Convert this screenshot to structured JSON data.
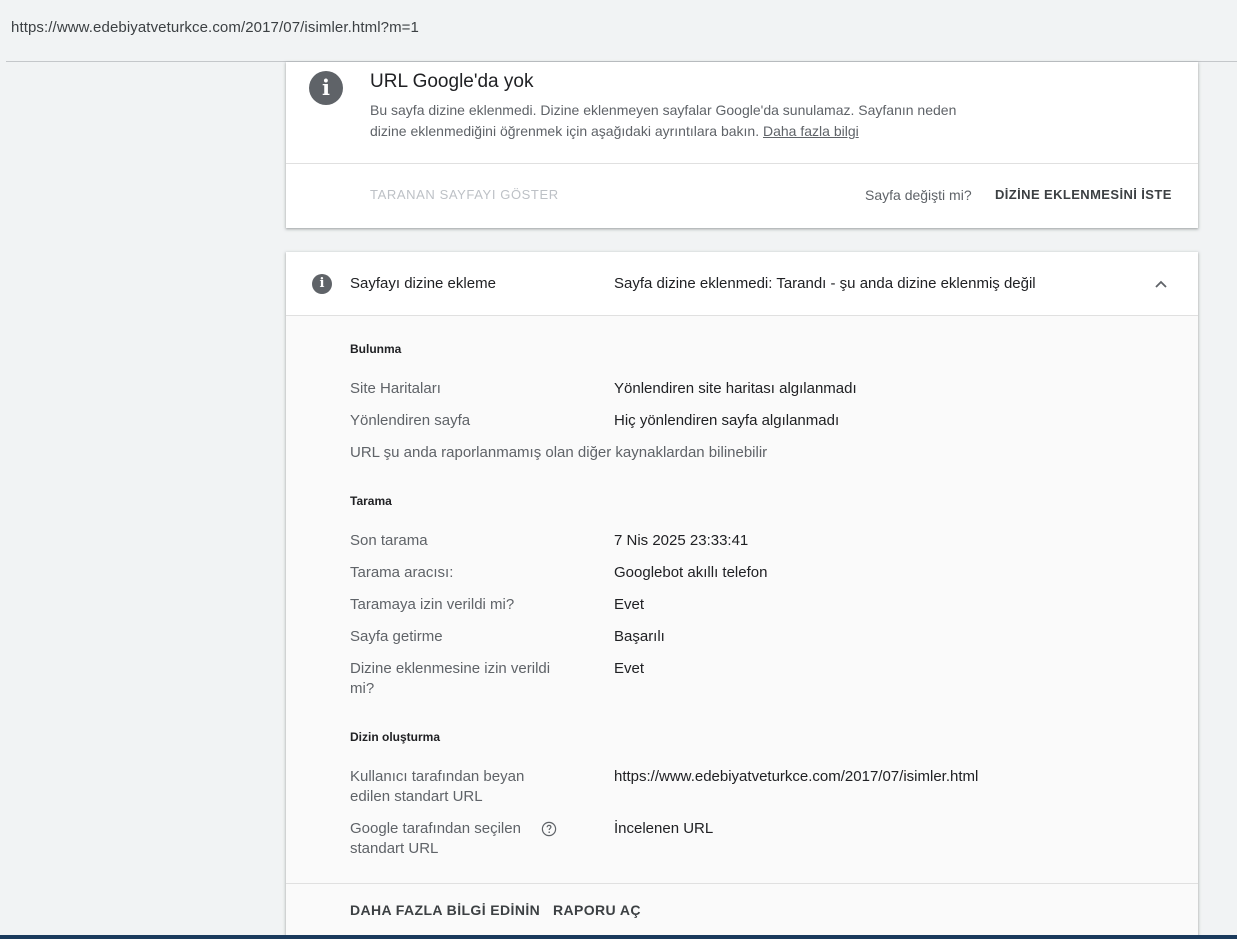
{
  "browser": {
    "url": "https://www.edebiyatveturkce.com/2017/07/isimler.html?m=1"
  },
  "status_card": {
    "title": "URL Google'da yok",
    "description": "Bu sayfa dizine eklenmedi. Dizine eklenmeyen sayfalar Google'da sunulamaz. Sayfanın neden dizine eklenmediğini öğrenmek için aşağıdaki ayrıntılara bakın.",
    "learn_more_link": "Daha fazla bilgi",
    "view_crawled_button": "TARANAN SAYFAYI GÖSTER",
    "page_changed_text": "Sayfa değişti mi?",
    "request_indexing_button": "DİZİNE EKLENMESİNİ İSTE"
  },
  "details_card": {
    "header_label": "Sayfayı dizine ekleme",
    "header_status": "Sayfa dizine eklenmedi: Tarandı - şu anda dizine eklenmiş değil",
    "discovery": {
      "title": "Bulunma",
      "sitemaps_label": "Site Haritaları",
      "sitemaps_value": "Yönlendiren site haritası algılanmadı",
      "referring_page_label": "Yönlendiren sayfa",
      "referring_page_value": "Hiç yönlendiren sayfa algılanmadı",
      "note": "URL şu anda raporlanmamış olan diğer kaynaklardan bilinebilir"
    },
    "crawl": {
      "title": "Tarama",
      "last_crawl_label": "Son tarama",
      "last_crawl_value": "7 Nis 2025 23:33:41",
      "crawled_as_label": "Tarama aracısı:",
      "crawled_as_value": "Googlebot akıllı telefon",
      "crawl_allowed_label": "Taramaya izin verildi mi?",
      "crawl_allowed_value": "Evet",
      "page_fetch_label": "Sayfa getirme",
      "page_fetch_value": "Başarılı",
      "indexing_allowed_label_line1": "Dizine eklenmesine izin verildi",
      "indexing_allowed_label_line2": "mi?",
      "indexing_allowed_value": "Evet"
    },
    "indexing": {
      "title": "Dizin oluşturma",
      "user_canonical_label_line1": "Kullanıcı tarafından beyan",
      "user_canonical_label_line2": "edilen standart URL",
      "user_canonical_value": "https://www.edebiyatveturkce.com/2017/07/isimler.html",
      "google_canonical_label_line1": "Google tarafından seçilen",
      "google_canonical_label_line2": "standart URL",
      "google_canonical_value": "İncelenen URL"
    },
    "footer": {
      "learn_more_button": "DAHA FAZLA BİLGİ EDİNİN",
      "open_report_button": "RAPORU AÇ"
    }
  }
}
